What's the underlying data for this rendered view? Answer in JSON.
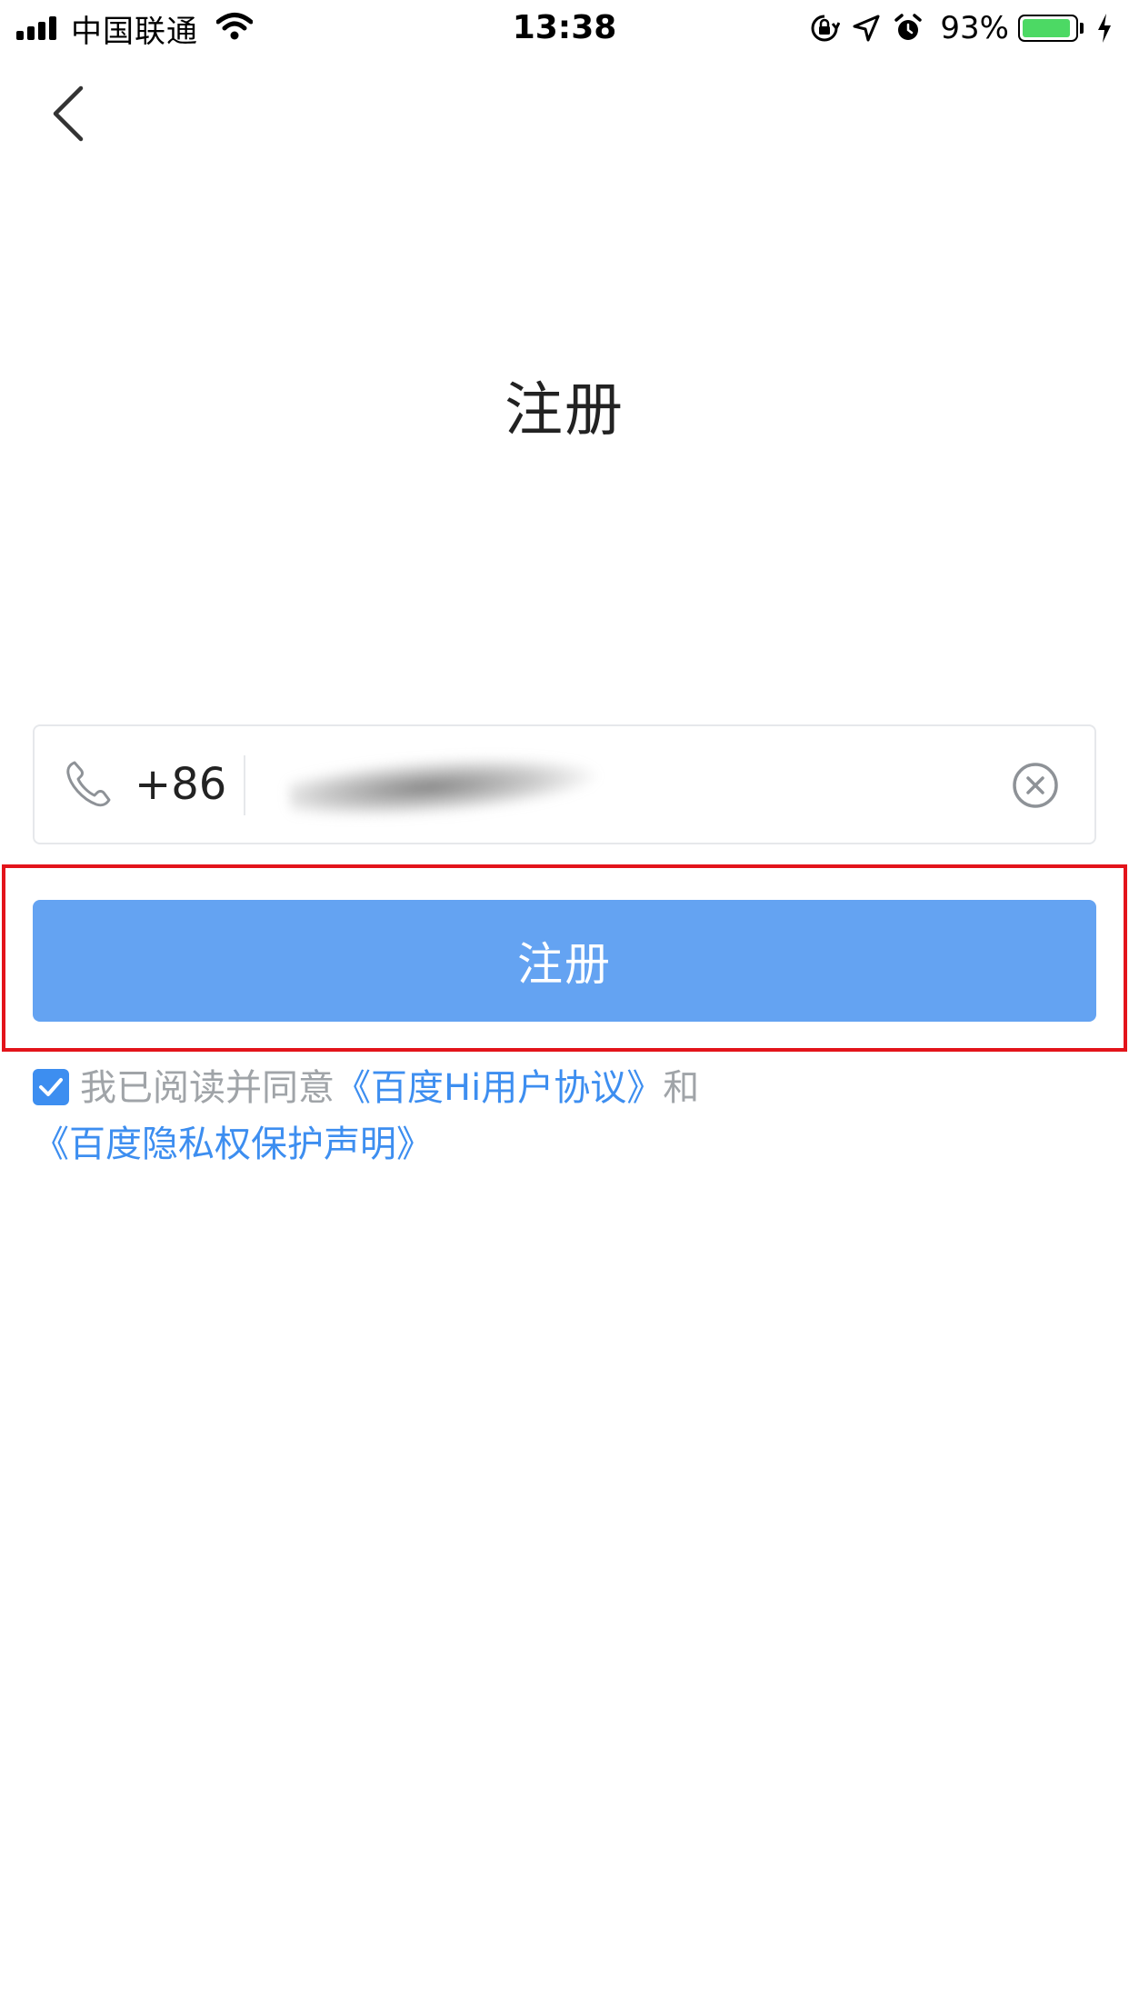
{
  "status_bar": {
    "carrier": "中国联通",
    "time": "13:38",
    "battery_percent": "93%",
    "battery_level": 0.93,
    "icons": [
      "signal-icon",
      "wifi-icon",
      "rotation-lock-icon",
      "location-icon",
      "alarm-icon",
      "battery-icon",
      "charging-icon"
    ]
  },
  "nav": {
    "back_icon": "chevron-left-icon"
  },
  "page": {
    "title": "注册"
  },
  "phone_field": {
    "icon": "phone-icon",
    "country_code": "+86",
    "value": "",
    "clear_icon": "clear-circle-icon"
  },
  "register_button": {
    "label": "注册",
    "color": "#64a3f2"
  },
  "agreement": {
    "checked": true,
    "prefix": "我已阅读并同意",
    "link1": "《百度Hi用户协议》",
    "conjunction": "和",
    "link2": "《百度隐私权保护声明》"
  },
  "colors": {
    "accent": "#3d8ef0",
    "highlight": "#e3141b"
  }
}
